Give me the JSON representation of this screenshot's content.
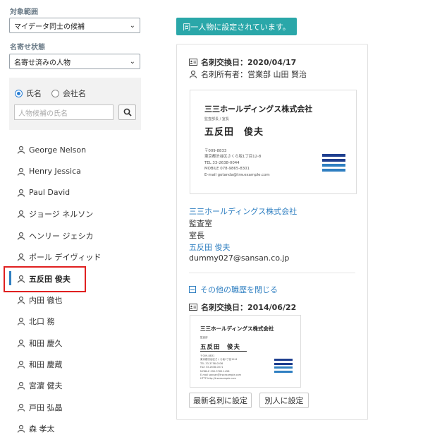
{
  "filters": {
    "scope_label": "対象範囲",
    "scope_value": "マイデータ同士の候補",
    "merge_label": "名寄せ状態",
    "merge_value": "名寄せ済みの人物"
  },
  "search": {
    "radio_name": "氏名",
    "radio_company": "会社名",
    "placeholder": "人物候補の氏名"
  },
  "people": [
    "George Nelson",
    "Henry Jessica",
    "Paul David",
    "ジョージ ネルソン",
    "ヘンリー ジェシカ",
    "ポール デイヴィッド",
    "五反田 俊夫",
    "内田 徹也",
    "北口 務",
    "和田 慶久",
    "和田 慶蔵",
    "宮濵 健夫",
    "戸田 弘晶",
    "森 孝太"
  ],
  "selected_person": "五反田 俊夫",
  "banner": "同一人物に設定されています。",
  "current": {
    "exchange_label": "名刺交換日：2020/04/17",
    "owner_label": "名刺所有者：営業部 山田 賢治",
    "company_link": "三三ホールディングス株式会社",
    "dept": "監査室",
    "title": "室長",
    "name_link": "五反田 俊夫",
    "email": "dummy027@sansan.co.jp"
  },
  "card1": {
    "company": "三三ホールディングス株式会社",
    "role": "監査部長 / 室長",
    "name": "五反田　俊夫",
    "address_lines": [
      "〒009-8833",
      "東京都渋谷区さくら坂1丁目12-8",
      "TEL 33-2638-0044",
      "MOBILE 078-9865-8301",
      "E-mail gotanda@trw.example.com"
    ]
  },
  "history": {
    "collapse_label": "その他の職歴を閉じる",
    "exchange_label": "名刺交換日：2014/06/22"
  },
  "card2": {
    "company": "三三ホールディングス株式会社",
    "role": "監査部",
    "name": "五反田　俊夫",
    "address_lines": [
      "〒009-8831",
      "東京都渋谷区さくら坂1丁目12-8",
      "TEL 33-3758-0036",
      "FAX 33-2638-0071",
      "MOBILE 090-3765-1458",
      "E-mail sansan@trw.example.com",
      "HTTP http://trw.example.com"
    ]
  },
  "actions": {
    "set_latest": "最新名刺に設定",
    "set_other": "別人に設定"
  },
  "colors": {
    "accent": "#2aa7a9",
    "link": "#2f7fc1",
    "highlight": "#e02020",
    "logo_dark": "#1f3f8f",
    "logo_light": "#2f7fc1"
  }
}
